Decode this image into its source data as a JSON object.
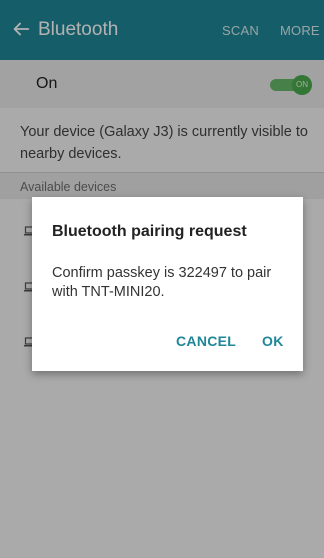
{
  "appbar": {
    "title": "Bluetooth",
    "actions": {
      "scan": "SCAN",
      "more": "MORE"
    },
    "back_icon": "arrow-left-icon",
    "color": "#1f8797"
  },
  "bluetooth": {
    "label": "On",
    "switch_text": "ON",
    "switch_state": true
  },
  "visibility_text": "Your device (Galaxy J3) is currently visible to nearby devices.",
  "available_devices": {
    "header": "Available devices",
    "device_icon": "laptop-icon"
  },
  "dialog": {
    "title": "Bluetooth pairing request",
    "message": "Confirm passkey is 322497 to pair with TNT-MINI20.",
    "buttons": {
      "cancel": "CANCEL",
      "ok": "OK"
    }
  }
}
